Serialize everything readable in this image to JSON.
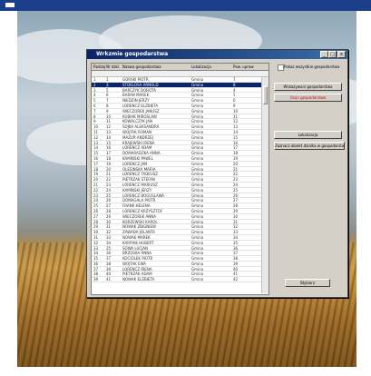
{
  "dialog": {
    "title": "Wrkzmie gospodarstwa",
    "titlebar_buttons": [
      "_",
      "□",
      "x"
    ]
  },
  "table": {
    "columns": [
      "Rodzaj",
      "Nr dzkl.",
      "Nazwa gospodarstwa",
      "Lokalizacja",
      "Pow. upraw"
    ],
    "rows": [
      [
        "1",
        "1",
        "GORSKI PIOTR",
        "Gmina",
        "7"
      ],
      [
        "2",
        "3",
        "STOKLOSA ARNOLD",
        "Gmina",
        "8"
      ],
      [
        "3",
        "5",
        "BARCZYK DOROTA",
        "Gmina",
        "4"
      ],
      [
        "4",
        "6",
        "BARAN MAREK",
        "Gmina",
        "5"
      ],
      [
        "5",
        "7",
        "NIEDZIN JERZY",
        "Gmina",
        "6"
      ],
      [
        "6",
        "8",
        "LORENCZ ELZBIETA",
        "Gmina",
        "9"
      ],
      [
        "7",
        "9",
        "WIECZOREK JANUSZ",
        "Gmina",
        "10"
      ],
      [
        "8",
        "10",
        "KUBIAK MIROSLAW",
        "Gmina",
        "11"
      ],
      [
        "9",
        "11",
        "KOWALCZYK JAN",
        "Gmina",
        "12"
      ],
      [
        "10",
        "12",
        "SOJKA ALEKSANDRA",
        "Gmina",
        "13"
      ],
      [
        "11",
        "13",
        "WOJTAK ROMAN",
        "Gmina",
        "14"
      ],
      [
        "12",
        "14",
        "MAZUR ANDRZEJ",
        "Gmina",
        "15"
      ],
      [
        "13",
        "15",
        "KRAJEWSKI IRENA",
        "Gmina",
        "16"
      ],
      [
        "14",
        "16",
        "LORENCZ ADAM",
        "Gmina",
        "17"
      ],
      [
        "15",
        "17",
        "DOMARADZKA ANNA",
        "Gmina",
        "18"
      ],
      [
        "16",
        "18",
        "KAMINSKI PAWEL",
        "Gmina",
        "19"
      ],
      [
        "17",
        "19",
        "LORENCZ JAN",
        "Gmina",
        "20"
      ],
      [
        "18",
        "20",
        "OLESINSKA MARIA",
        "Gmina",
        "21"
      ],
      [
        "19",
        "21",
        "LORENCZ TADEUSZ",
        "Gmina",
        "22"
      ],
      [
        "20",
        "22",
        "PIETRZAK STEFAN",
        "Gmina",
        "23"
      ],
      [
        "21",
        "23",
        "LORENCZ MARIUSZ",
        "Gmina",
        "24"
      ],
      [
        "22",
        "24",
        "KAMINSKI JERZY",
        "Gmina",
        "25"
      ],
      [
        "23",
        "25",
        "LORENCZ BOGUSLAWA",
        "Gmina",
        "26"
      ],
      [
        "24",
        "26",
        "DOMAGALA PIOTR",
        "Gmina",
        "27"
      ],
      [
        "25",
        "27",
        "FRANK HELENA",
        "Gmina",
        "28"
      ],
      [
        "26",
        "28",
        "LORENCZ KRZYSZTOF",
        "Gmina",
        "29"
      ],
      [
        "27",
        "29",
        "WIECZOREK ANNA",
        "Gmina",
        "30"
      ],
      [
        "28",
        "30",
        "KORZEWSKI KAROL",
        "Gmina",
        "31"
      ],
      [
        "29",
        "31",
        "NOWAK ZBIGNIEW",
        "Gmina",
        "32"
      ],
      [
        "30",
        "32",
        "ZAWADA JOLANTA",
        "Gmina",
        "33"
      ],
      [
        "31",
        "33",
        "NOWAK MAREK",
        "Gmina",
        "34"
      ],
      [
        "32",
        "34",
        "KARPIAK HUBERT",
        "Gmina",
        "35"
      ],
      [
        "33",
        "35",
        "SOWA LUCJAN",
        "Gmina",
        "36"
      ],
      [
        "34",
        "36",
        "BRZOSKA ANNA",
        "Gmina",
        "37"
      ],
      [
        "35",
        "37",
        "KOCIOLEK PIOTR",
        "Gmina",
        "38"
      ],
      [
        "36",
        "38",
        "WOJTAK EWA",
        "Gmina",
        "39"
      ],
      [
        "37",
        "39",
        "LORENCZ IRENA",
        "Gmina",
        "40"
      ],
      [
        "38",
        "40",
        "PIETRZAK ADAM",
        "Gmina",
        "41"
      ],
      [
        "39",
        "41",
        "NOWAK ELZBIETA",
        "Gmina",
        "42"
      ]
    ]
  },
  "panel": {
    "checkbox_label": "Pokaz wszystkie gospodarstwa",
    "buttons": [
      {
        "label": "Wskazywani gospodarstwa",
        "color": "#000000"
      },
      {
        "label": "Usun gospodarstwo",
        "color": "#cc0000"
      },
      {
        "label": "Lokalizacja",
        "color": "#000000"
      },
      {
        "label": "Zaznacz obiekt dzialka w gospodarstwie",
        "color": "#000000"
      },
      {
        "label": "Wybierz",
        "color": "#000000"
      }
    ]
  }
}
